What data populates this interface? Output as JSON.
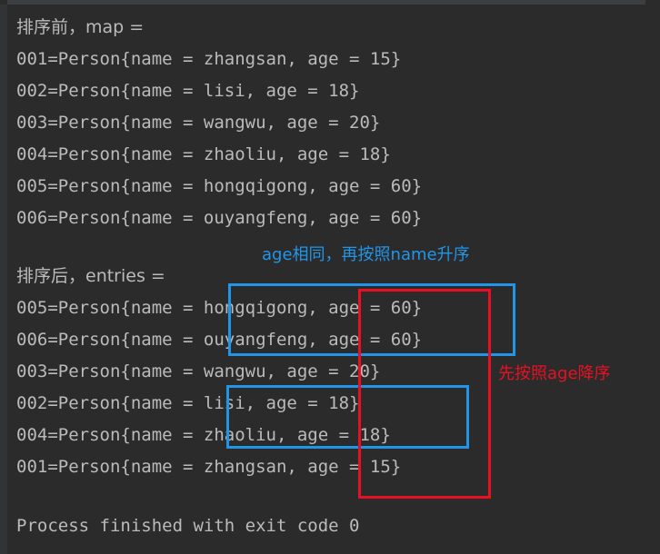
{
  "console": {
    "background_color": "#2b2b2b",
    "text_color": "#bbbbbb",
    "accent_blue": "#2196e8",
    "accent_red": "#e81123",
    "lines": [
      {
        "id": "line-0",
        "text": "排序前，map ="
      },
      {
        "id": "line-1",
        "text": "001=Person{name = zhangsan, age = 15}"
      },
      {
        "id": "line-2",
        "text": "002=Person{name = lisi, age = 18}"
      },
      {
        "id": "line-3",
        "text": "003=Person{name = wangwu, age = 20}"
      },
      {
        "id": "line-4",
        "text": "004=Person{name = zhaoliu, age = 18}"
      },
      {
        "id": "line-5",
        "text": "005=Person{name = hongqigong, age = 60}"
      },
      {
        "id": "line-6",
        "text": "006=Person{name = ouyangfeng, age = 60}"
      },
      {
        "id": "line-7",
        "text": ""
      },
      {
        "id": "line-8",
        "text": "排序后，entries ="
      },
      {
        "id": "line-9",
        "text": "005=Person{name = hongqigong, age = 60}"
      },
      {
        "id": "line-10",
        "text": "006=Person{name = ouyangfeng, age = 60}"
      },
      {
        "id": "line-11",
        "text": "003=Person{name = wangwu, age = 20}"
      },
      {
        "id": "line-12",
        "text": "002=Person{name = lisi, age = 18}"
      },
      {
        "id": "line-13",
        "text": "004=Person{name = zhaoliu, age = 18}"
      },
      {
        "id": "line-14",
        "text": "001=Person{name = zhangsan, age = 15}"
      },
      {
        "id": "line-15",
        "text": ""
      },
      {
        "id": "line-16",
        "text": "Process finished with exit code 0"
      }
    ]
  },
  "annotations": {
    "blue_note": "age相同，再按照name升序",
    "red_note": "先按照age降序"
  }
}
